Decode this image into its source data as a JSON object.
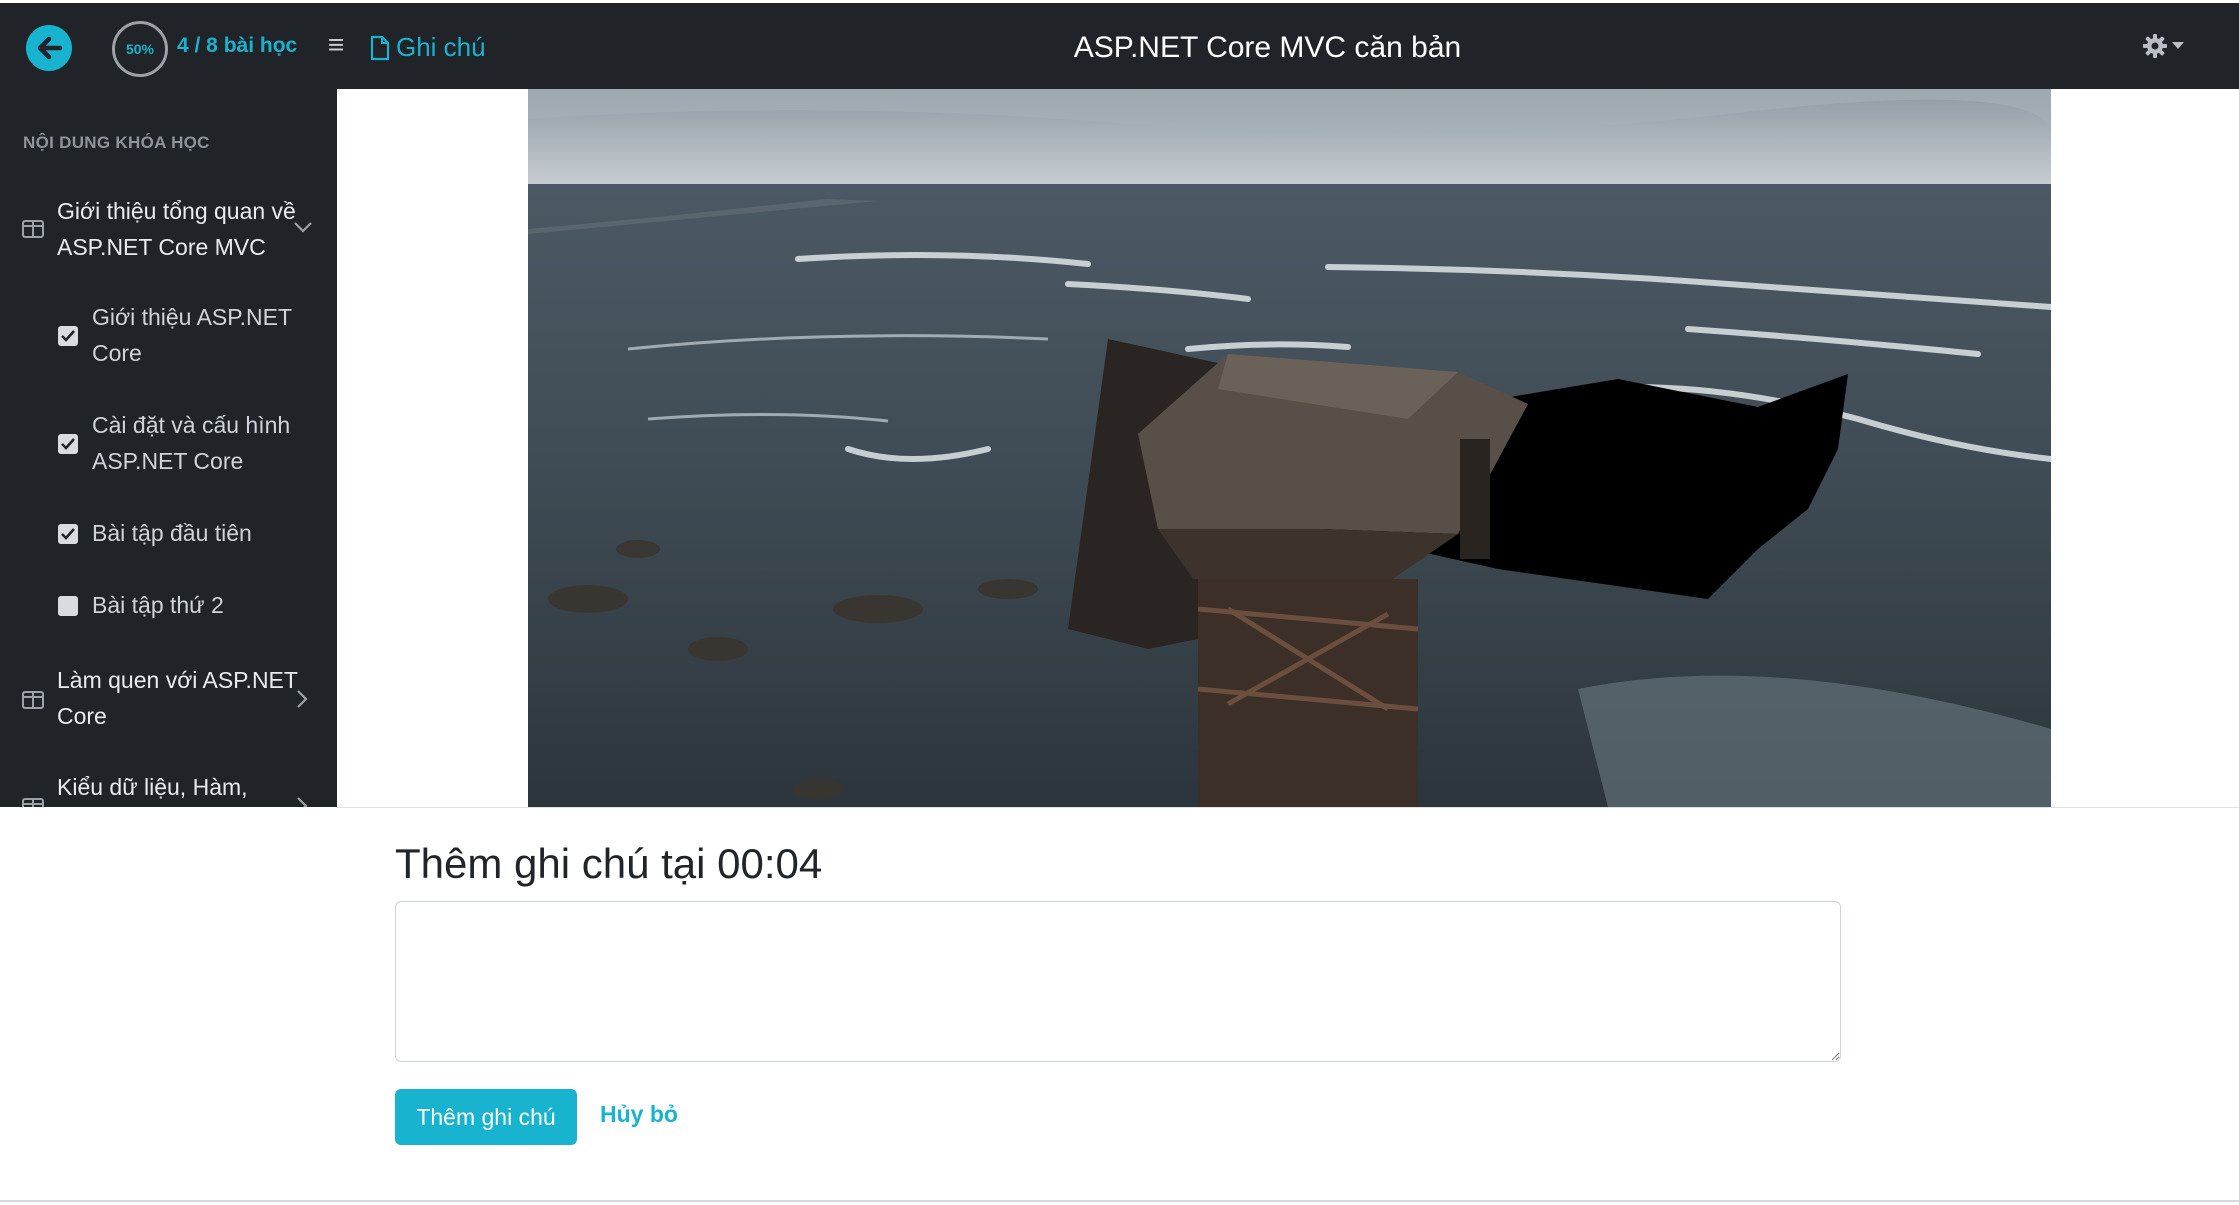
{
  "header": {
    "progress_percent_label": "50%",
    "progress_fraction": 0.5,
    "lessons_progress": "4 / 8 bài học",
    "notes_label": "Ghi chú",
    "course_title": "ASP.NET Core MVC căn bản"
  },
  "sidebar": {
    "heading": "NỘI DUNG KHÓA HỌC",
    "sections": [
      {
        "title": "Giới thiệu tổng quan về ASP.NET Core MVC",
        "expanded": true,
        "lessons": [
          {
            "title": "Giới thiệu ASP.NET Core",
            "completed": true
          },
          {
            "title": "Cài đặt và cấu hình ASP.NET Core",
            "completed": true
          },
          {
            "title": "Bài tập đầu tiên",
            "completed": true
          },
          {
            "title": "Bài tập thứ 2",
            "completed": false
          }
        ]
      },
      {
        "title": "Làm quen với ASP.NET Core",
        "expanded": false
      },
      {
        "title": "Kiểu dữ liệu, Hàm,",
        "expanded": false
      }
    ]
  },
  "note_form": {
    "heading": "Thêm ghi chú tại 00:04",
    "textarea_value": "",
    "add_button": "Thêm ghi chú",
    "cancel_button": "Hủy bỏ"
  },
  "colors": {
    "accent": "#17b3cf",
    "dark_bg": "#202328"
  },
  "icons": [
    "back-arrow-icon",
    "menu-icon",
    "file-icon",
    "gear-icon",
    "caret-down-icon",
    "book-icon",
    "chevron-down-icon",
    "chevron-right-icon",
    "checkbox-icon"
  ]
}
